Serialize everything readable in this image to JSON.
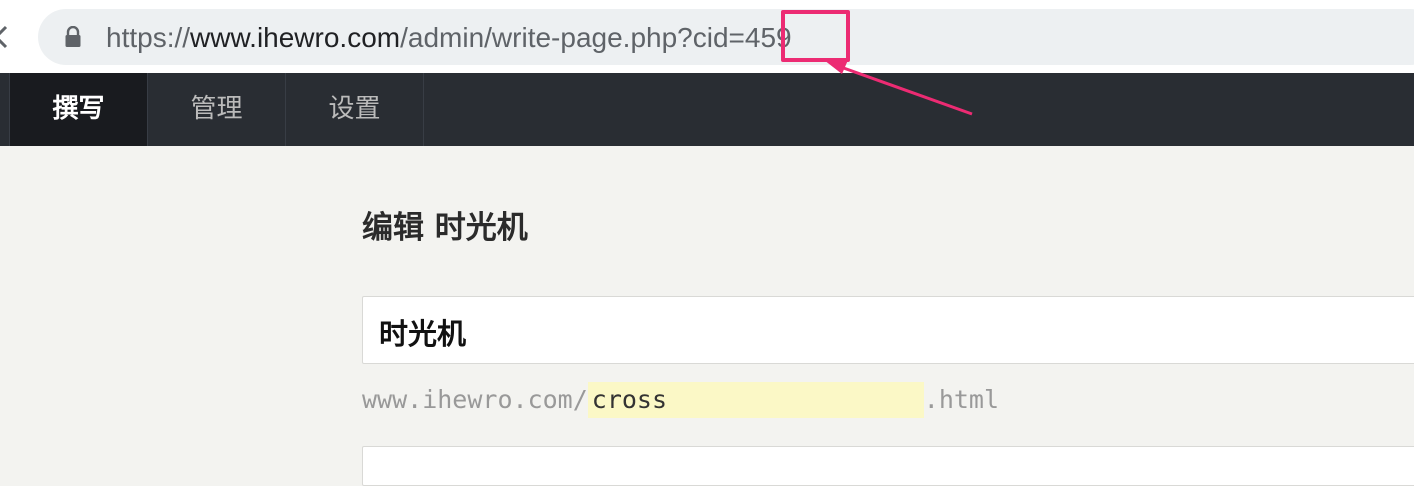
{
  "browser": {
    "url_scheme": "https://",
    "url_host": "www.ihewro.com",
    "url_path": "/admin/write-page.php?cid=",
    "url_cid": "459",
    "annotation_color": "#ec2b73"
  },
  "nav": {
    "items": [
      {
        "label": "撰写",
        "active": true
      },
      {
        "label": "管理",
        "active": false
      },
      {
        "label": "设置",
        "active": false
      }
    ]
  },
  "editor": {
    "page_title": "编辑 时光机",
    "title_value": "时光机",
    "slug_prefix": "www.ihewro.com/",
    "slug_value": "cross",
    "slug_suffix": ".html",
    "content_value": ""
  },
  "colors": {
    "nav_bg": "#292d33",
    "page_bg": "#f3f3f0",
    "slug_highlight": "#fbf8c6"
  }
}
